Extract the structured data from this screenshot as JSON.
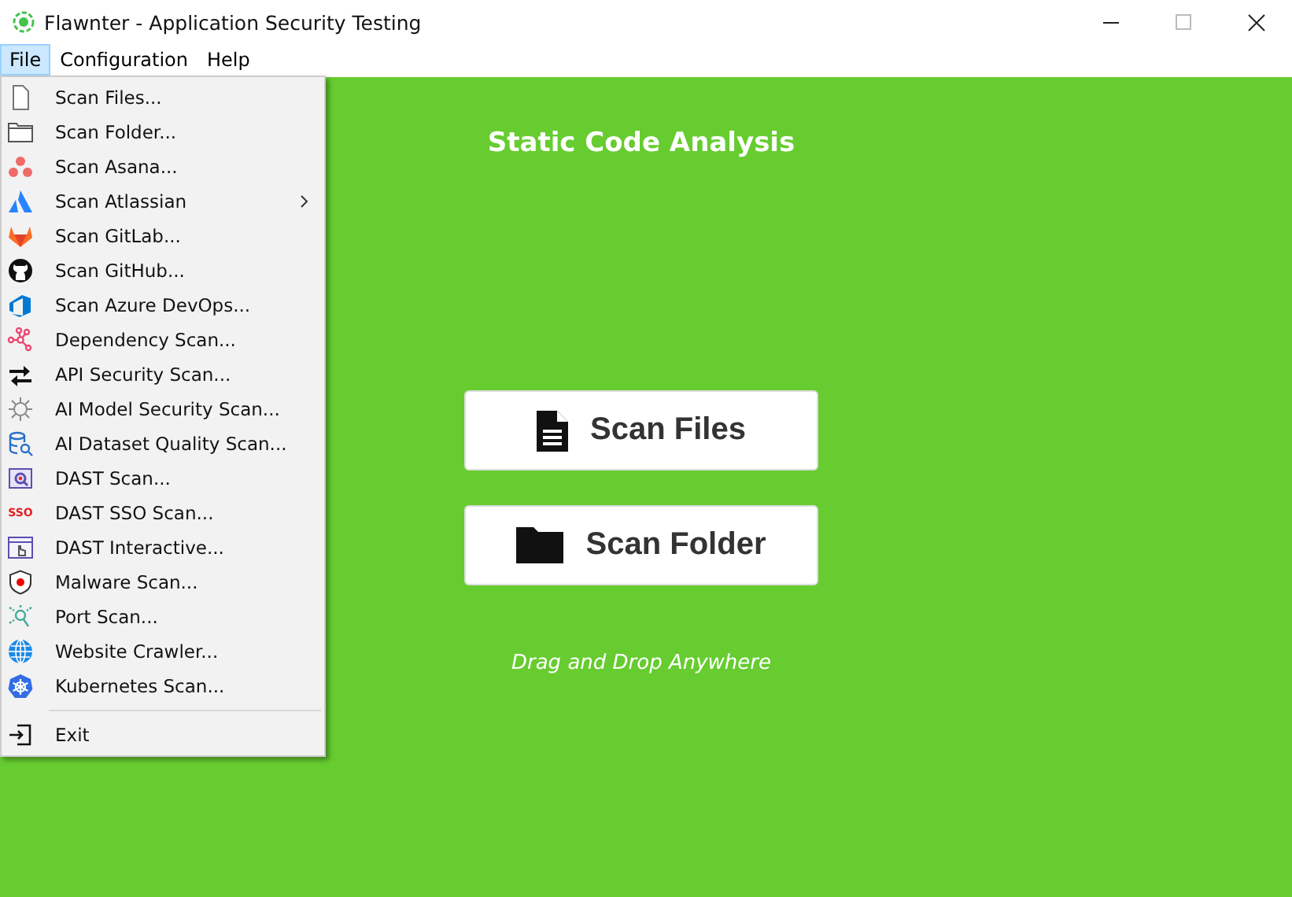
{
  "window": {
    "title": "Flawnter - Application Security Testing"
  },
  "menubar": [
    {
      "label": "File",
      "selected": true
    },
    {
      "label": "Configuration",
      "selected": false
    },
    {
      "label": "Help",
      "selected": false
    }
  ],
  "file_menu": [
    {
      "kind": "item",
      "label": "Scan Files..."
    },
    {
      "kind": "item",
      "label": "Scan Folder..."
    },
    {
      "kind": "item",
      "label": "Scan Asana..."
    },
    {
      "kind": "item",
      "label": "Scan Atlassian",
      "submenu": true
    },
    {
      "kind": "item",
      "label": "Scan GitLab..."
    },
    {
      "kind": "item",
      "label": "Scan GitHub..."
    },
    {
      "kind": "item",
      "label": "Scan Azure DevOps..."
    },
    {
      "kind": "item",
      "label": "Dependency Scan..."
    },
    {
      "kind": "item",
      "label": "API Security Scan..."
    },
    {
      "kind": "item",
      "label": "AI Model Security Scan..."
    },
    {
      "kind": "item",
      "label": "AI Dataset Quality Scan..."
    },
    {
      "kind": "item",
      "label": "DAST Scan..."
    },
    {
      "kind": "item",
      "label": "DAST SSO Scan...",
      "icon_text": "SSO"
    },
    {
      "kind": "item",
      "label": "DAST Interactive..."
    },
    {
      "kind": "item",
      "label": "Malware Scan..."
    },
    {
      "kind": "item",
      "label": "Port Scan..."
    },
    {
      "kind": "item",
      "label": "Website Crawler..."
    },
    {
      "kind": "item",
      "label": "Kubernetes Scan..."
    },
    {
      "kind": "separator"
    },
    {
      "kind": "item",
      "label": "Exit"
    }
  ],
  "main": {
    "heading": "Static Code Analysis",
    "buttons": [
      {
        "label": "Scan Files"
      },
      {
        "label": "Scan Folder"
      }
    ],
    "hint": "Drag and Drop Anywhere"
  }
}
